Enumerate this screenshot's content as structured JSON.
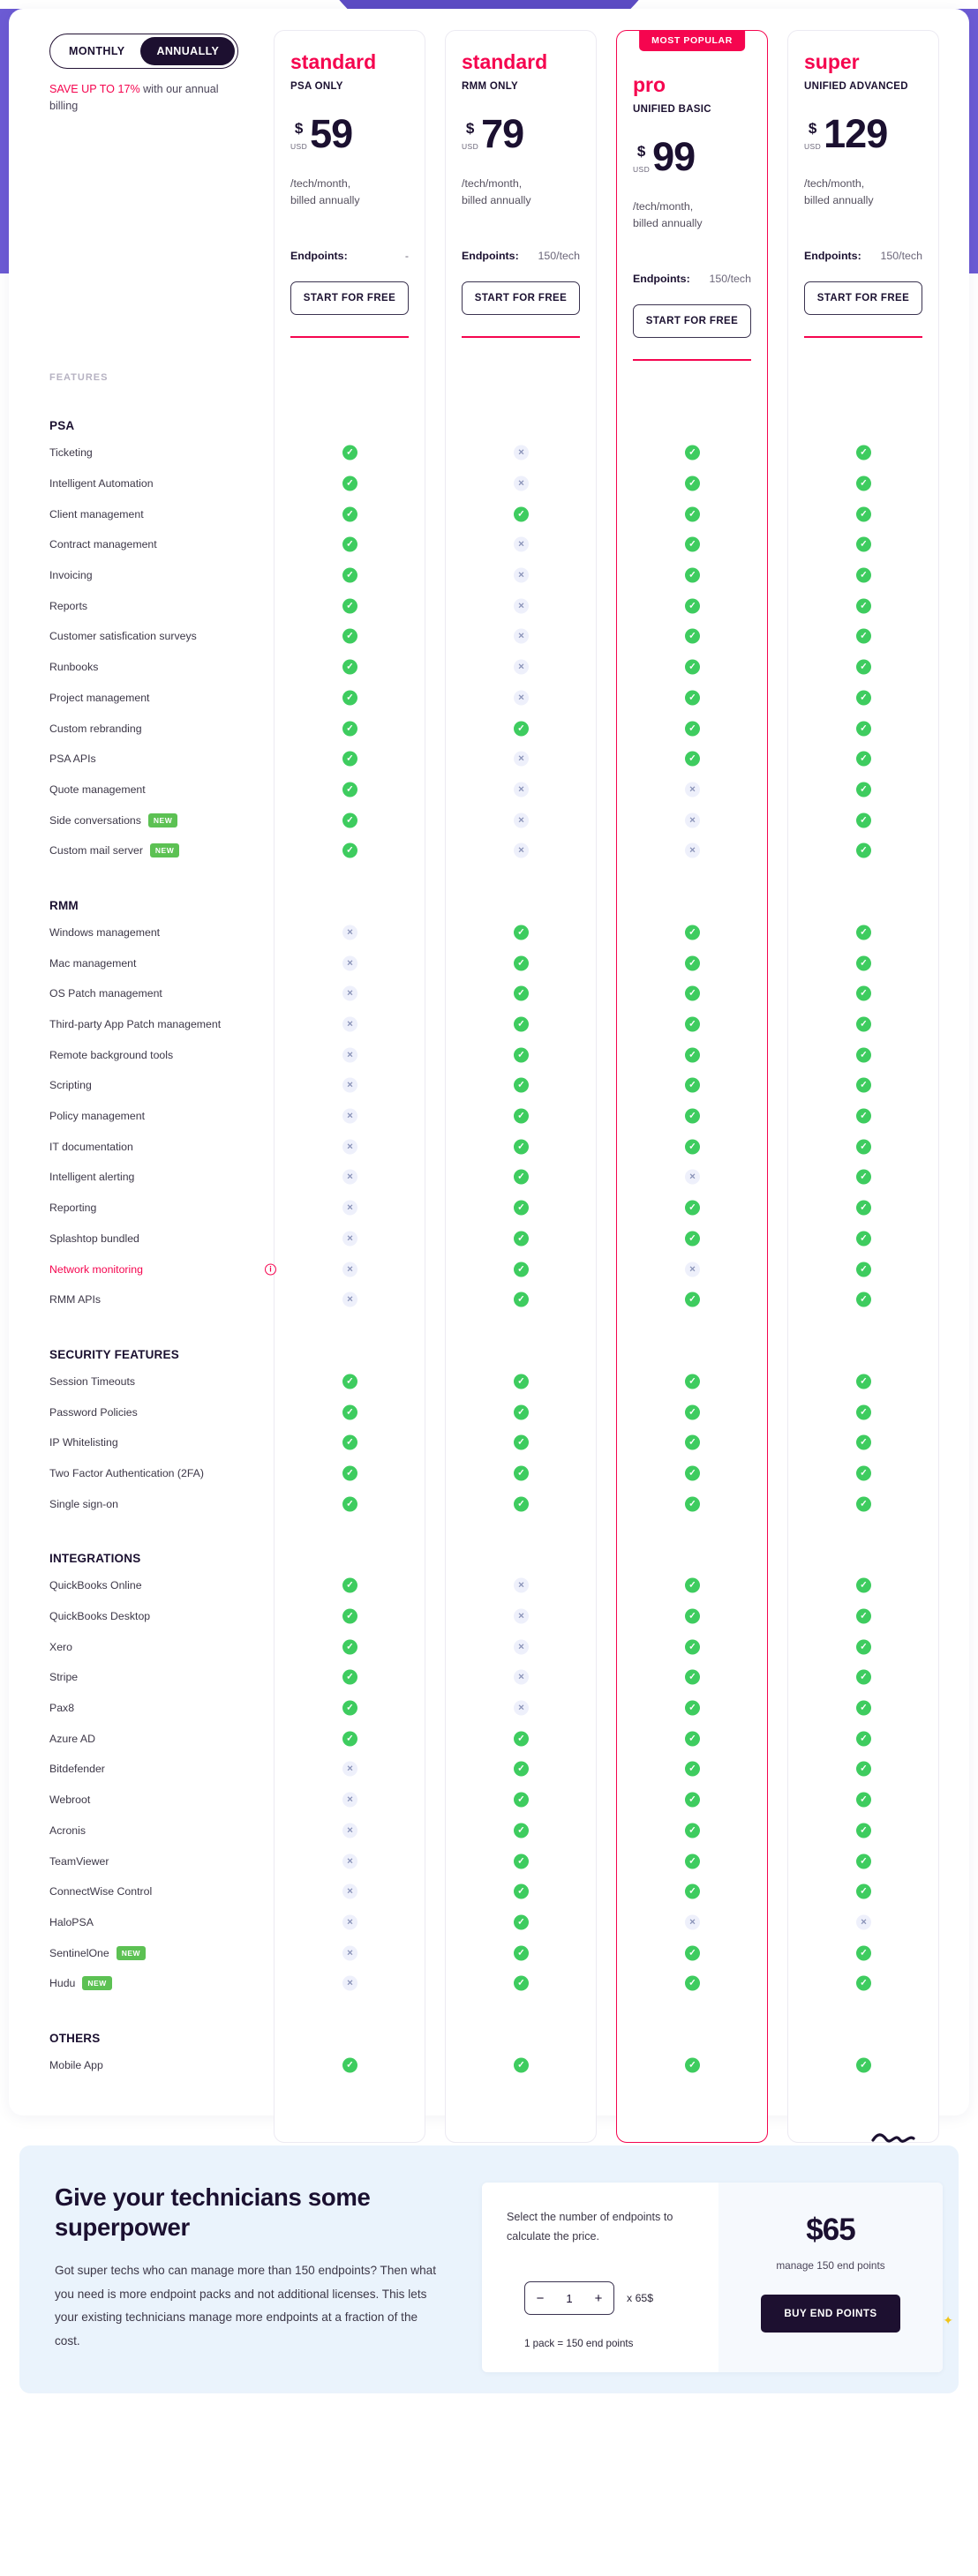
{
  "billing": {
    "monthly_label": "MONTHLY",
    "annually_label": "ANNUALLY",
    "active": "ANNUALLY",
    "save_highlight": "SAVE UP TO 17%",
    "save_rest": " with our annual billing"
  },
  "plans": [
    {
      "name": "standard",
      "subtitle": "PSA ONLY",
      "badge": "",
      "currency_symbol": "$",
      "currency_code": "USD",
      "amount": "59",
      "period": "/tech/month,\nbilled annually",
      "endpoints_label": "Endpoints:",
      "endpoints_value": "-",
      "cta": "START FOR FREE"
    },
    {
      "name": "standard",
      "subtitle": "RMM ONLY",
      "badge": "",
      "currency_symbol": "$",
      "currency_code": "USD",
      "amount": "79",
      "period": "/tech/month,\nbilled annually",
      "endpoints_label": "Endpoints:",
      "endpoints_value": "150/tech",
      "cta": "START FOR FREE"
    },
    {
      "name": "pro",
      "subtitle": "UNIFIED BASIC",
      "badge": "MOST POPULAR",
      "currency_symbol": "$",
      "currency_code": "USD",
      "amount": "99",
      "period": "/tech/month,\nbilled annually",
      "endpoints_label": "Endpoints:",
      "endpoints_value": "150/tech",
      "cta": "START FOR FREE"
    },
    {
      "name": "super",
      "subtitle": "UNIFIED ADVANCED",
      "badge": "",
      "currency_symbol": "$",
      "currency_code": "USD",
      "amount": "129",
      "period": "/tech/month,\nbilled annually",
      "endpoints_label": "Endpoints:",
      "endpoints_value": "150/tech",
      "cta": "START FOR FREE"
    }
  ],
  "features_label": "FEATURES",
  "sections": [
    {
      "title": "PSA",
      "rows": [
        {
          "label": "Ticketing",
          "marks": [
            true,
            false,
            true,
            true
          ]
        },
        {
          "label": "Intelligent Automation",
          "marks": [
            true,
            false,
            true,
            true
          ]
        },
        {
          "label": "Client management",
          "marks": [
            true,
            true,
            true,
            true
          ]
        },
        {
          "label": "Contract management",
          "marks": [
            true,
            false,
            true,
            true
          ]
        },
        {
          "label": "Invoicing",
          "marks": [
            true,
            false,
            true,
            true
          ]
        },
        {
          "label": "Reports",
          "marks": [
            true,
            false,
            true,
            true
          ]
        },
        {
          "label": "Customer satisfication surveys",
          "marks": [
            true,
            false,
            true,
            true
          ]
        },
        {
          "label": "Runbooks",
          "marks": [
            true,
            false,
            true,
            true
          ]
        },
        {
          "label": "Project management",
          "marks": [
            true,
            false,
            true,
            true
          ]
        },
        {
          "label": "Custom rebranding",
          "marks": [
            true,
            true,
            true,
            true
          ]
        },
        {
          "label": "PSA APIs",
          "marks": [
            true,
            false,
            true,
            true
          ]
        },
        {
          "label": "Quote management",
          "marks": [
            true,
            false,
            false,
            true
          ]
        },
        {
          "label": "Side conversations",
          "tag": "NEW",
          "marks": [
            true,
            false,
            false,
            true
          ]
        },
        {
          "label": "Custom mail server",
          "tag": "NEW",
          "marks": [
            true,
            false,
            false,
            true
          ]
        }
      ]
    },
    {
      "title": "RMM",
      "rows": [
        {
          "label": "Windows management",
          "marks": [
            false,
            true,
            true,
            true
          ]
        },
        {
          "label": "Mac management",
          "marks": [
            false,
            true,
            true,
            true
          ]
        },
        {
          "label": "OS Patch management",
          "marks": [
            false,
            true,
            true,
            true
          ]
        },
        {
          "label": "Third-party App Patch management",
          "marks": [
            false,
            true,
            true,
            true
          ]
        },
        {
          "label": "Remote background tools",
          "marks": [
            false,
            true,
            true,
            true
          ]
        },
        {
          "label": "Scripting",
          "marks": [
            false,
            true,
            true,
            true
          ]
        },
        {
          "label": "Policy management",
          "marks": [
            false,
            true,
            true,
            true
          ]
        },
        {
          "label": "IT documentation",
          "marks": [
            false,
            true,
            true,
            true
          ]
        },
        {
          "label": "Intelligent alerting",
          "marks": [
            false,
            true,
            false,
            true
          ]
        },
        {
          "label": "Reporting",
          "marks": [
            false,
            true,
            true,
            true
          ]
        },
        {
          "label": "Splashtop bundled",
          "marks": [
            false,
            true,
            true,
            true
          ]
        },
        {
          "label": "Network monitoring",
          "alert": true,
          "info": true,
          "marks": [
            false,
            true,
            false,
            true
          ]
        },
        {
          "label": "RMM APIs",
          "marks": [
            false,
            true,
            true,
            true
          ]
        }
      ]
    },
    {
      "title": "SECURITY FEATURES",
      "rows": [
        {
          "label": "Session Timeouts",
          "marks": [
            true,
            true,
            true,
            true
          ]
        },
        {
          "label": "Password Policies",
          "marks": [
            true,
            true,
            true,
            true
          ]
        },
        {
          "label": "IP Whitelisting",
          "marks": [
            true,
            true,
            true,
            true
          ]
        },
        {
          "label": "Two Factor Authentication (2FA)",
          "marks": [
            true,
            true,
            true,
            true
          ]
        },
        {
          "label": "Single sign-on",
          "marks": [
            true,
            true,
            true,
            true
          ]
        }
      ]
    },
    {
      "title": "INTEGRATIONS",
      "rows": [
        {
          "label": "QuickBooks Online",
          "marks": [
            true,
            false,
            true,
            true
          ]
        },
        {
          "label": "QuickBooks Desktop",
          "marks": [
            true,
            false,
            true,
            true
          ]
        },
        {
          "label": "Xero",
          "marks": [
            true,
            false,
            true,
            true
          ]
        },
        {
          "label": "Stripe",
          "marks": [
            true,
            false,
            true,
            true
          ]
        },
        {
          "label": "Pax8",
          "marks": [
            true,
            false,
            true,
            true
          ]
        },
        {
          "label": "Azure AD",
          "marks": [
            true,
            true,
            true,
            true
          ]
        },
        {
          "label": "Bitdefender",
          "marks": [
            false,
            true,
            true,
            true
          ]
        },
        {
          "label": "Webroot",
          "marks": [
            false,
            true,
            true,
            true
          ]
        },
        {
          "label": "Acronis",
          "marks": [
            false,
            true,
            true,
            true
          ]
        },
        {
          "label": "TeamViewer",
          "marks": [
            false,
            true,
            true,
            true
          ]
        },
        {
          "label": "ConnectWise Control",
          "marks": [
            false,
            true,
            true,
            true
          ]
        },
        {
          "label": "HaloPSA",
          "marks": [
            false,
            true,
            false,
            false
          ]
        },
        {
          "label": "SentinelOne",
          "tag": "NEW",
          "marks": [
            false,
            true,
            true,
            true
          ]
        },
        {
          "label": "Hudu",
          "tag": "NEW",
          "marks": [
            false,
            true,
            true,
            true
          ]
        }
      ]
    },
    {
      "title": "OTHERS",
      "rows": [
        {
          "label": "Mobile App",
          "marks": [
            true,
            true,
            true,
            true
          ]
        }
      ]
    }
  ],
  "superpower": {
    "title": "Give your technicians some superpower",
    "body": "Got super techs who can manage more than 150 endpoints? Then what you need is more endpoint packs and not additional licenses. This lets your existing technicians manage more endpoints at a fraction of the cost.",
    "calculator": {
      "prompt": "Select the number of endpoints to calculate the price.",
      "minus": "−",
      "plus": "+",
      "quantity": "1",
      "multiplier": "x 65$",
      "pack_note": "1 pack = 150 end points",
      "price": "$65",
      "caption": "manage 150 end points",
      "buy_label": "BUY END POINTS"
    }
  },
  "colors": {
    "accent_pink": "#f5054f",
    "ink": "#1b1030",
    "green": "#3ecc5f",
    "band_purple": "#6c5bd4",
    "new_green": "#5cc153"
  }
}
